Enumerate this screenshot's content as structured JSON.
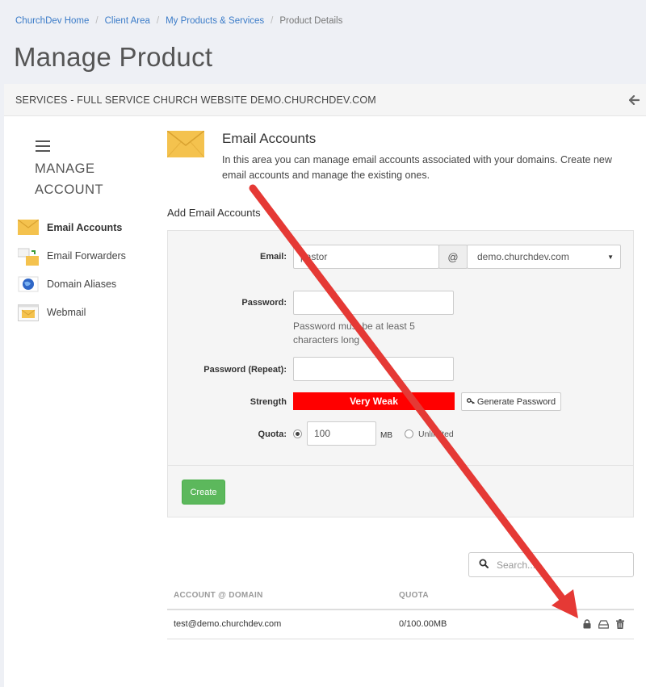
{
  "breadcrumb": {
    "items": [
      "ChurchDev Home",
      "Client Area",
      "My Products & Services"
    ],
    "current": "Product Details",
    "separator": "/"
  },
  "page_title": "Manage Product",
  "panel": {
    "title": "SERVICES - FULL SERVICE CHURCH WEBSITE DEMO.CHURCHDEV.COM",
    "back_icon": "arrow-left-icon"
  },
  "sidebar": {
    "menu_line1": "MANAGE",
    "menu_line2": "ACCOUNT",
    "items": [
      {
        "label": "Email Accounts",
        "icon": "envelope-icon",
        "active": true
      },
      {
        "label": "Email Forwarders",
        "icon": "forwarder-icon",
        "active": false
      },
      {
        "label": "Domain Aliases",
        "icon": "globe-icon",
        "active": false
      },
      {
        "label": "Webmail",
        "icon": "webmail-icon",
        "active": false
      }
    ]
  },
  "content": {
    "title": "Email Accounts",
    "description": "In this area you can manage email accounts associated with your domains. Create new email accounts and manage the existing ones.",
    "add_heading": "Add Email Accounts"
  },
  "form": {
    "email_label": "Email:",
    "email_value": "pastor",
    "at_symbol": "@",
    "domain_value": "demo.churchdev.com",
    "password_label": "Password:",
    "password_help": "Password must be at least 5 characters long",
    "password_repeat_label": "Password (Repeat):",
    "strength_label": "Strength",
    "strength_value": "Very Weak",
    "generate_label": "Generate Password",
    "quota_label": "Quota:",
    "quota_value": "100",
    "quota_unit": "MB",
    "unlimited_label": "Unlimited",
    "create_label": "Create"
  },
  "search": {
    "placeholder": "Search..."
  },
  "table": {
    "columns": [
      "ACCOUNT @ DOMAIN",
      "QUOTA"
    ],
    "rows": [
      {
        "account": "test@demo.churchdev.com",
        "quota": "0/100.00MB"
      }
    ]
  },
  "colors": {
    "accent": "#3a7bc8",
    "strength_bar": "#ff0000",
    "create_button": "#5cb85c",
    "annotation_arrow": "#e53935"
  }
}
